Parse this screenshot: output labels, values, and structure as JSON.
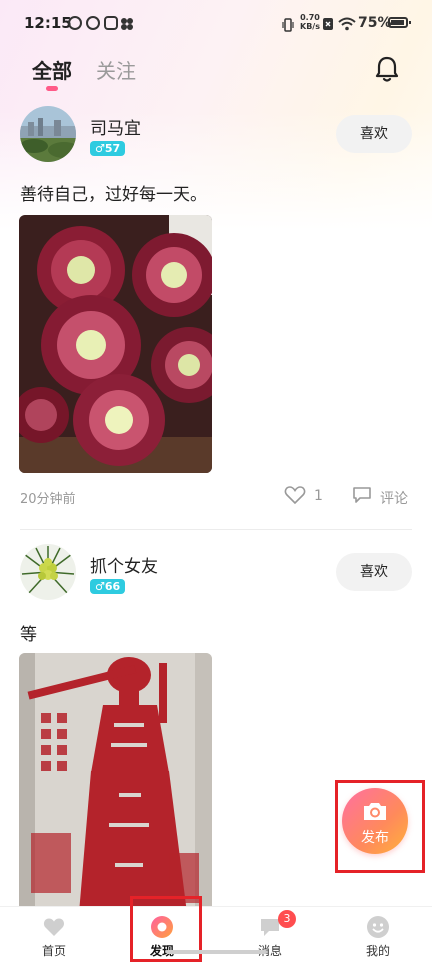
{
  "status_bar": {
    "time": "12:15",
    "net_speed_value": "0.70",
    "net_speed_unit": "KB/s",
    "battery": "75%"
  },
  "tabs": [
    {
      "label": "全部",
      "active": true
    },
    {
      "label": "关注",
      "active": false
    }
  ],
  "posts": [
    {
      "username": "司马宜",
      "badge": "♂57",
      "like_button": "喜欢",
      "text": "善待自己，过好每一天。",
      "time": "20分钟前",
      "likes": "1",
      "comment_label": "评论"
    },
    {
      "username": "抓个女友",
      "badge": "♂66",
      "like_button": "喜欢",
      "text": "等"
    }
  ],
  "fab": {
    "label": "发布",
    "icon": "camera-icon"
  },
  "bottom_nav": [
    {
      "label": "首页",
      "icon": "heart-icon",
      "active": false
    },
    {
      "label": "发现",
      "icon": "discover-icon",
      "active": true
    },
    {
      "label": "消息",
      "icon": "message-icon",
      "badge": "3",
      "active": false
    },
    {
      "label": "我的",
      "icon": "smile-icon",
      "active": false
    }
  ],
  "colors": {
    "accent_pink": "#ff5a88",
    "badge_cyan": "#2ecbe0",
    "highlight_red": "#e52228",
    "notification_red": "#ff4d4f"
  }
}
